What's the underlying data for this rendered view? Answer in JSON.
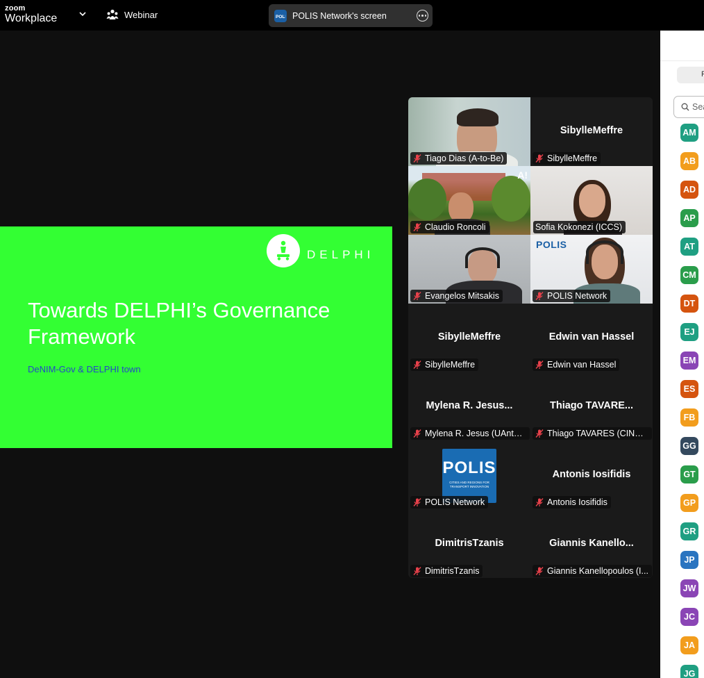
{
  "topbar": {
    "logo_line1": "zoom",
    "logo_line2": "Workplace",
    "webinar_label": "Webinar",
    "share_label": "POLIS Network's screen",
    "share_icon": "polis-logo-icon"
  },
  "slide": {
    "brand": "DELPHI",
    "title": "Towards DELPHI’s Governance Framework",
    "subtitle": "DeNIM-Gov & DELPHI town",
    "background": "#33ff33"
  },
  "gallery": {
    "tiles": [
      {
        "label": "Tiago Dias (A-to-Be)",
        "center": ""
      },
      {
        "label": "SibylleMeffre",
        "center": "SibylleMeffre"
      },
      {
        "label": "Claudio Roncoli",
        "center": "",
        "badge": "A!"
      },
      {
        "label": "Sofia Kokonezi (ICCS)",
        "center": ""
      },
      {
        "label": "Evangelos Mitsakis",
        "center": ""
      },
      {
        "label": "POLIS Network",
        "center": "",
        "badge": "POLIS"
      },
      {
        "label": "SibylleMeffre",
        "center": "SibylleMeffre"
      },
      {
        "label": "Edwin van Hassel",
        "center": "Edwin van Hassel"
      },
      {
        "label": "Mylena R. Jesus (UAntw...",
        "center": "Mylena R. Jesus..."
      },
      {
        "label": "Thiago TAVARES (CINEA)",
        "center": "Thiago  TAVARE..."
      },
      {
        "label": "POLIS Network",
        "center": "",
        "logo_text": "POLIS",
        "logo_sub": "CITIES AND REGIONS FOR TRANSPORT INNOVATION"
      },
      {
        "label": "Antonis Iosifidis",
        "center": "Antonis Iosifidis"
      },
      {
        "label": "DimitrisTzanis",
        "center": "DimitrisTzanis"
      },
      {
        "label": "Giannis Kanellopoulos (I...",
        "center": "Giannis  Kanello..."
      }
    ]
  },
  "panel": {
    "tab_label": "P",
    "search_placeholder": "Search",
    "avatars": [
      {
        "initials": "AM",
        "color": "#1f9f82"
      },
      {
        "initials": "AB",
        "color": "#f29d1d"
      },
      {
        "initials": "AD",
        "color": "#d5540f"
      },
      {
        "initials": "AP",
        "color": "#2a9d4b"
      },
      {
        "initials": "AT",
        "color": "#1f9f82"
      },
      {
        "initials": "CM",
        "color": "#2a9d4b"
      },
      {
        "initials": "DT",
        "color": "#d5540f"
      },
      {
        "initials": "EJ",
        "color": "#1f9f82"
      },
      {
        "initials": "EM",
        "color": "#8a45b5"
      },
      {
        "initials": "ES",
        "color": "#d5540f"
      },
      {
        "initials": "FB",
        "color": "#f29d1d"
      },
      {
        "initials": "GG",
        "color": "#34495e"
      },
      {
        "initials": "GT",
        "color": "#2a9d4b"
      },
      {
        "initials": "GP",
        "color": "#f29d1d"
      },
      {
        "initials": "GR",
        "color": "#1f9f82"
      },
      {
        "initials": "JP",
        "color": "#2a74c0"
      },
      {
        "initials": "JW",
        "color": "#8a45b5"
      },
      {
        "initials": "JC",
        "color": "#8a45b5"
      },
      {
        "initials": "JA",
        "color": "#f29d1d"
      },
      {
        "initials": "JG",
        "color": "#1f9f82"
      }
    ]
  }
}
